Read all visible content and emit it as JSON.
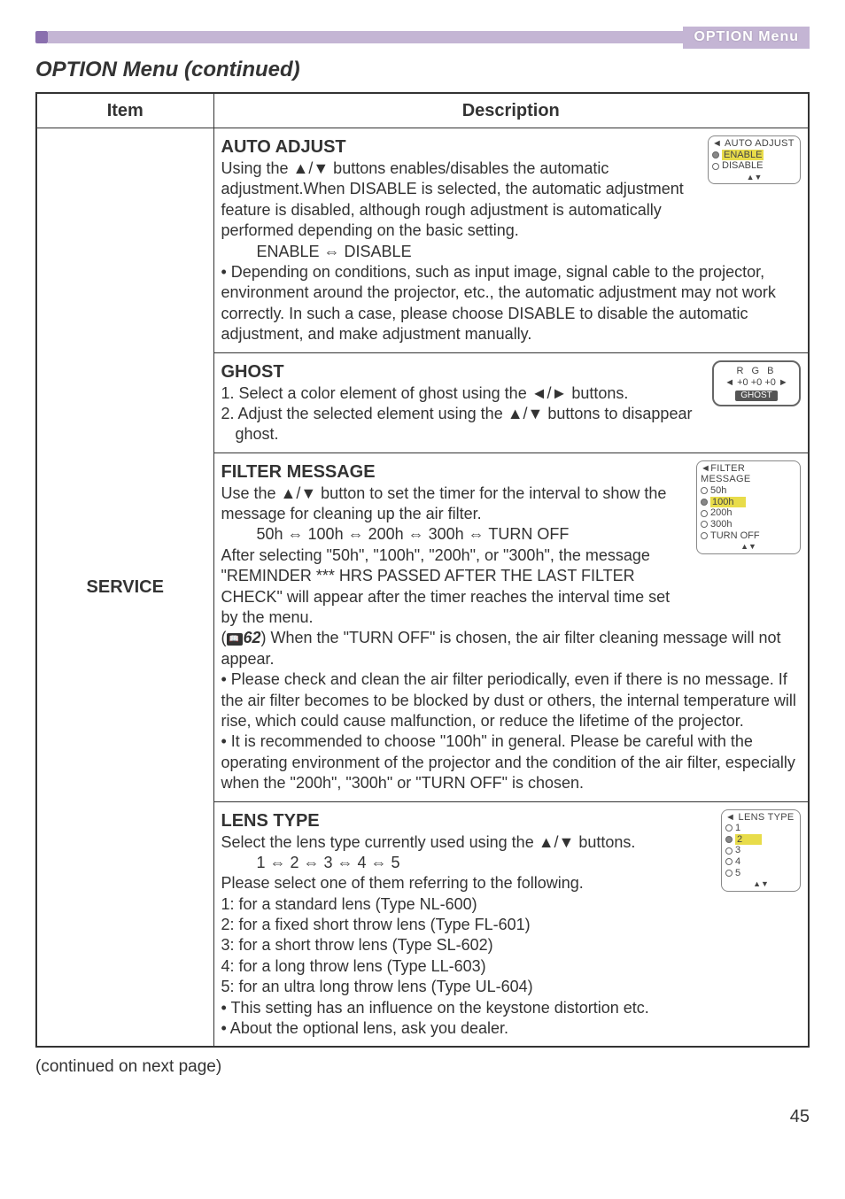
{
  "topbar": {
    "badge": "OPTION Menu"
  },
  "heading": "OPTION Menu (continued)",
  "table": {
    "headers": {
      "item": "Item",
      "desc": "Description"
    },
    "item_label": "SERVICE"
  },
  "auto_adjust": {
    "title": "AUTO ADJUST",
    "p1": "Using the ▲/▼ buttons enables/disables the automatic adjustment.When DISABLE is selected, the automatic adjustment feature is disabled, although rough adjustment is automatically performed depending on the basic setting.",
    "toggle": "ENABLE ⇔ DISABLE",
    "p2": "• Depending on conditions, such as input image, signal cable to the projector, environment around the projector, etc., the automatic adjustment may not work correctly.  In such a case, please choose DISABLE to disable the automatic adjustment, and make adjustment manually.",
    "osd": {
      "title": "AUTO ADJUST",
      "o1": "ENABLE",
      "o2": "DISABLE"
    }
  },
  "ghost": {
    "title": "GHOST",
    "l1": "1. Select a color element of ghost using the ◄/► buttons.",
    "l2": "2. Adjust the selected element using the ▲/▼ buttons to disappear ghost.",
    "osd": {
      "rgb": "R   G   B",
      "vals": "◄ +0 +0 +0 ►",
      "label": "GHOST"
    }
  },
  "filter": {
    "title": "FILTER MESSAGE",
    "p1": "Use the ▲/▼ button to set the timer for the interval to show the message for cleaning up the air filter.",
    "opts": "50h ⇔ 100h ⇔ 200h ⇔ 300h ⇔ TURN OFF",
    "p2": "After selecting \"50h\", \"100h\", \"200h\", or \"300h\", the message \"REMINDER *** HRS PASSED AFTER THE LAST FILTER CHECK\" will appear after the timer reaches the interval time set by the menu.",
    "ref_num": "62",
    "p3": ") When the \"TURN OFF\" is chosen, the air filter cleaning message will not appear.",
    "p4": "• Please check and clean the air filter periodically, even if there is no message. If the air filter becomes to be blocked by dust or others, the internal temperature will rise, which could cause malfunction, or reduce the lifetime of the projector.",
    "p5": "• It is recommended to choose \"100h\" in general. Please be careful with the operating environment of the projector and the condition of the air filter, especially when the \"200h\", \"300h\" or \"TURN OFF\" is chosen.",
    "osd": {
      "title": "FILTER MESSAGE",
      "o1": "50h",
      "o2": "100h",
      "o3": "200h",
      "o4": "300h",
      "o5": "TURN OFF"
    }
  },
  "lens": {
    "title": "LENS TYPE",
    "p1": "Select the lens type currently used using the ▲/▼ buttons.",
    "opts": "1 ⇔ 2 ⇔ 3 ⇔ 4 ⇔ 5",
    "p2": "Please select one of them referring to the following.",
    "l1": "1: for a standard lens (Type NL-600)",
    "l2": "2: for a fixed short throw lens (Type FL-601)",
    "l3": "3: for a short throw lens (Type SL-602)",
    "l4": "4: for a long throw lens (Type LL-603)",
    "l5": "5: for an ultra long throw lens (Type UL-604)",
    "p3": "• This setting has an influence on the keystone distortion etc.",
    "p4": "• About the optional lens, ask you dealer.",
    "osd": {
      "title": "LENS TYPE",
      "o1": "1",
      "o2": "2",
      "o3": "3",
      "o4": "4",
      "o5": "5"
    }
  },
  "continued": "(continued on next page)",
  "page": "45"
}
